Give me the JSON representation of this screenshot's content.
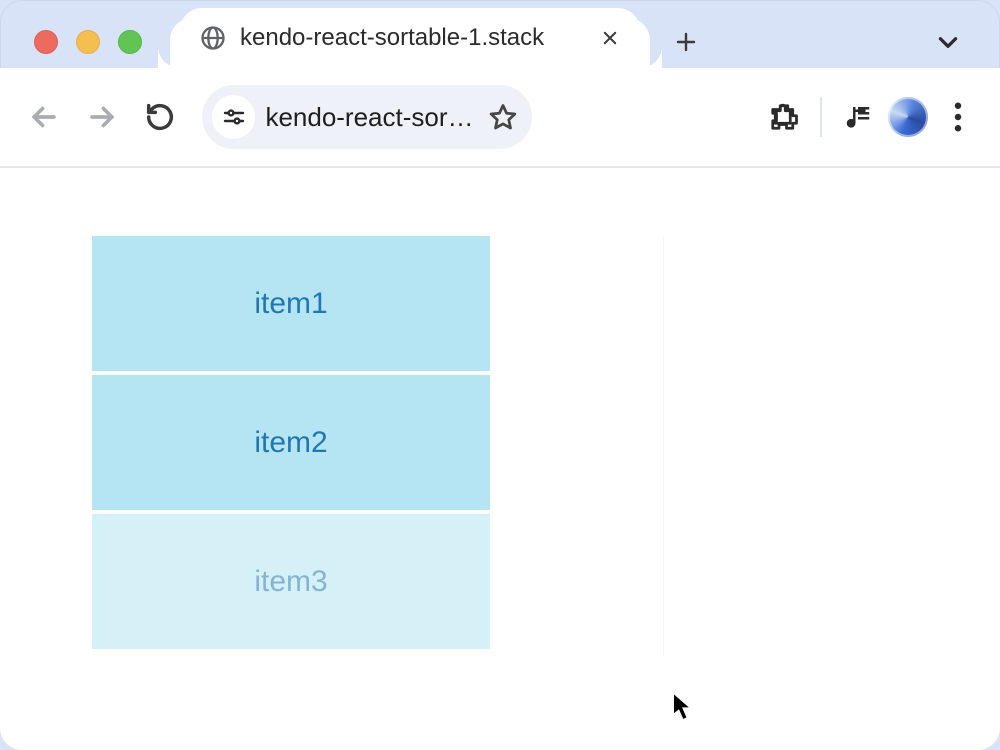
{
  "window": {
    "tab_title": "kendo-react-sortable-1.stack",
    "url_display": "kendo-react-sort…"
  },
  "sortable": {
    "items": [
      {
        "label": "item1",
        "dragging": false
      },
      {
        "label": "item2",
        "dragging": false
      },
      {
        "label": "item3",
        "dragging": true
      }
    ]
  }
}
